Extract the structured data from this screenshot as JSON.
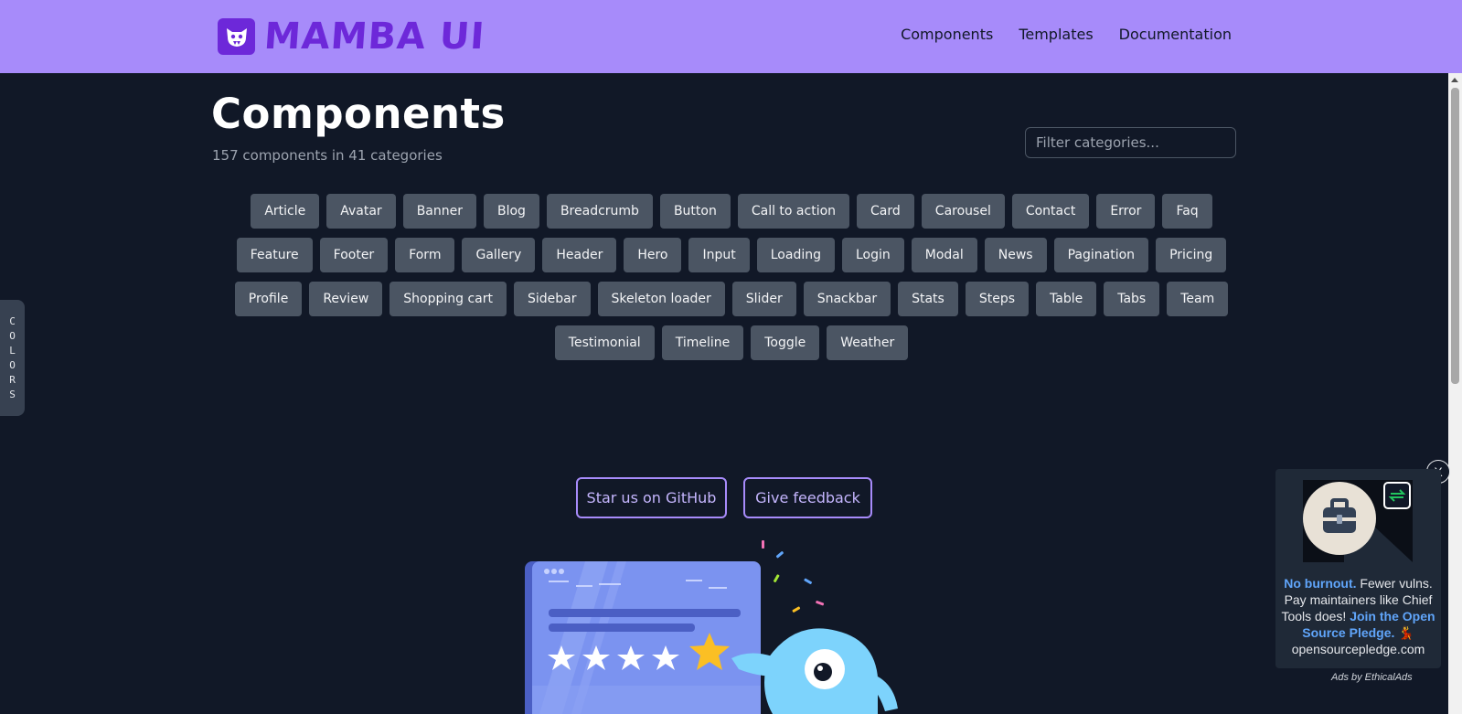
{
  "header": {
    "logo_text": "MAMBA UI",
    "nav": [
      "Components",
      "Templates",
      "Documentation"
    ]
  },
  "main": {
    "title": "Components",
    "subtitle": "157 components in 41 categories",
    "filter_placeholder": "Filter categories...",
    "categories": [
      "Article",
      "Avatar",
      "Banner",
      "Blog",
      "Breadcrumb",
      "Button",
      "Call to action",
      "Card",
      "Carousel",
      "Contact",
      "Error",
      "Faq",
      "Feature",
      "Footer",
      "Form",
      "Gallery",
      "Header",
      "Hero",
      "Input",
      "Loading",
      "Login",
      "Modal",
      "News",
      "Pagination",
      "Pricing",
      "Profile",
      "Review",
      "Shopping cart",
      "Sidebar",
      "Skeleton loader",
      "Slider",
      "Snackbar",
      "Stats",
      "Steps",
      "Table",
      "Tabs",
      "Team",
      "Testimonial",
      "Timeline",
      "Toggle",
      "Weather"
    ],
    "github_button": "Star us on GitHub",
    "feedback_button": "Give feedback"
  },
  "colors_tab": [
    "C",
    "O",
    "L",
    "O",
    "R",
    "S"
  ],
  "ad": {
    "close": "X",
    "text_bold_1": "No burnout.",
    "text_1": " Fewer vulns. Pay maintainers like Chief Tools does! ",
    "text_bold_2": "Join the Open Source Pledge.",
    "emoji": "💃",
    "domain": "opensourcepledge.com",
    "by": "Ads by EthicalAds"
  },
  "colors": {
    "header_bg": "#a78bfa",
    "brand": "#6d28d9",
    "page_bg": "#111827",
    "chip_bg": "#4b5563"
  }
}
